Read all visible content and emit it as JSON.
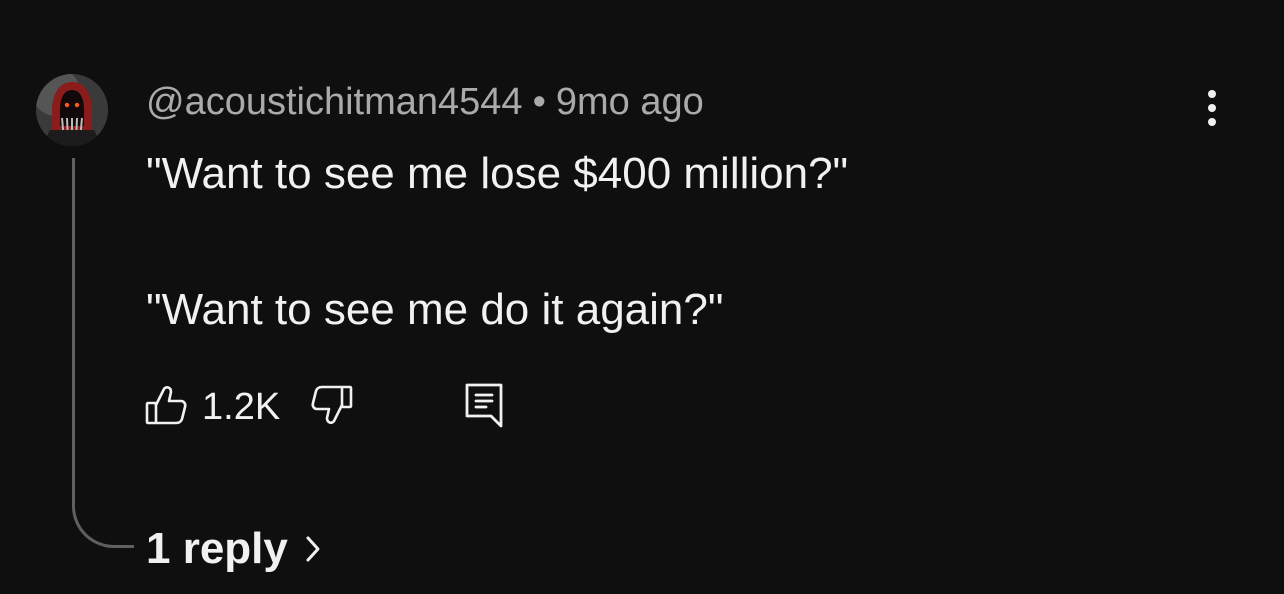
{
  "comment": {
    "author": "@acoustichitman4544",
    "separator": "•",
    "timestamp": "9mo ago",
    "lines": [
      "\"Want to see me lose $400 million?\"",
      "\"Want to see me do it again?\""
    ],
    "like_count": "1.2K",
    "replies_label": "1 reply"
  },
  "icons": {
    "avatar": "avatar-hooded-figure",
    "menu": "more-vert-icon",
    "like": "thumbs-up-icon",
    "dislike": "thumbs-down-icon",
    "reply": "comment-reply-icon",
    "chevron": "chevron-right-icon"
  },
  "colors": {
    "background": "#0f0f0f",
    "text": "#f1f1f1",
    "secondary_text": "#aaaaaa",
    "thread_line": "#606060"
  }
}
